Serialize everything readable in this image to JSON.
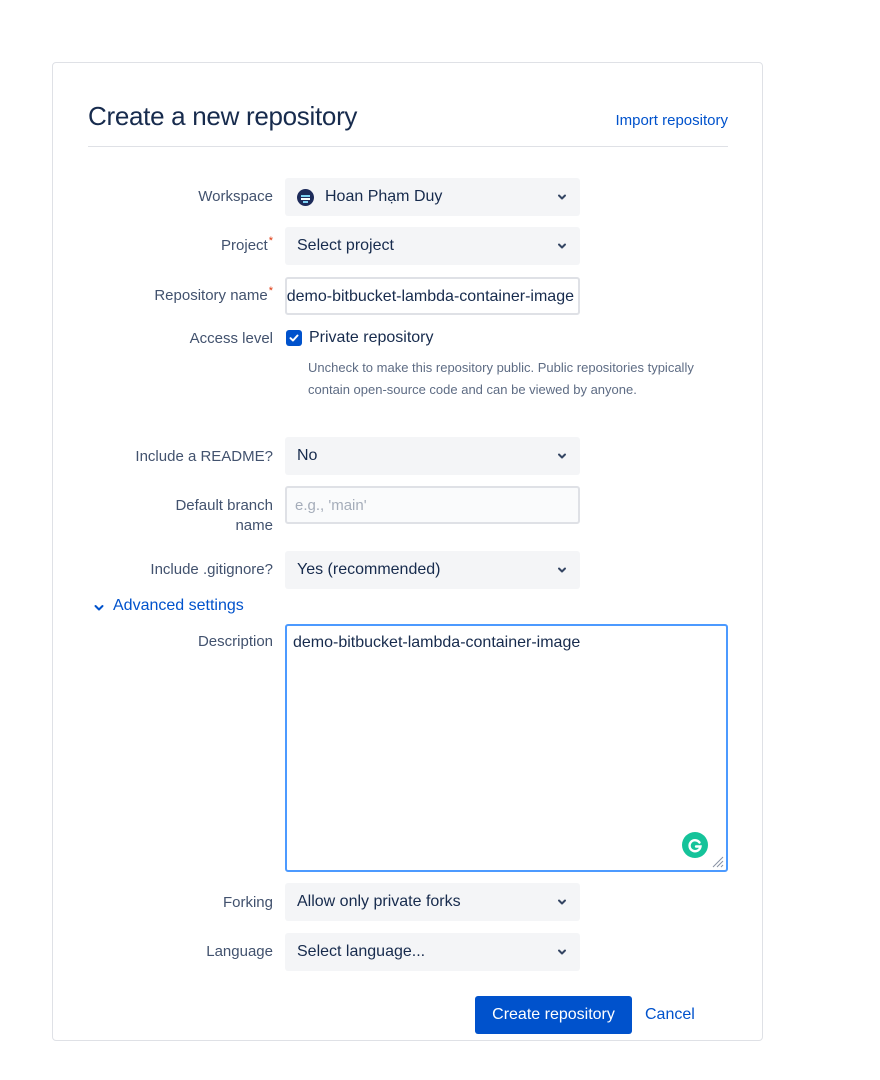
{
  "page": {
    "title": "Create a new repository",
    "import_link": "Import repository"
  },
  "form": {
    "workspace": {
      "label": "Workspace",
      "value": "Hoan Phạm Duy"
    },
    "project": {
      "label": "Project",
      "required_mark": "*",
      "value": "Select project"
    },
    "repository_name": {
      "label": "Repository name",
      "required_mark": "*",
      "value": "demo-bitbucket-lambda-container-image"
    },
    "access_level": {
      "label": "Access level",
      "checkbox_label": "Private repository",
      "checked": true,
      "help": "Uncheck to make this repository public. Public repositories typically contain open-source code and can be viewed by anyone."
    },
    "readme": {
      "label": "Include a README?",
      "value": "No"
    },
    "default_branch": {
      "label_line1": "Default branch",
      "label_line2": "name",
      "placeholder": "e.g., 'main'"
    },
    "gitignore": {
      "label": "Include .gitignore?",
      "value": "Yes (recommended)"
    },
    "advanced_settings": {
      "label": "Advanced settings",
      "icon": "chevron-down-icon"
    },
    "description": {
      "label": "Description",
      "value": "demo-bitbucket-lambda-container-image"
    },
    "forking": {
      "label": "Forking",
      "value": "Allow only private forks"
    },
    "language": {
      "label": "Language",
      "value": "Select language..."
    }
  },
  "actions": {
    "create": "Create repository",
    "cancel": "Cancel"
  },
  "colors": {
    "primary": "#0052cc",
    "required": "#de350b",
    "grammarly": "#15c39a",
    "focus_border": "#4c9aff"
  }
}
